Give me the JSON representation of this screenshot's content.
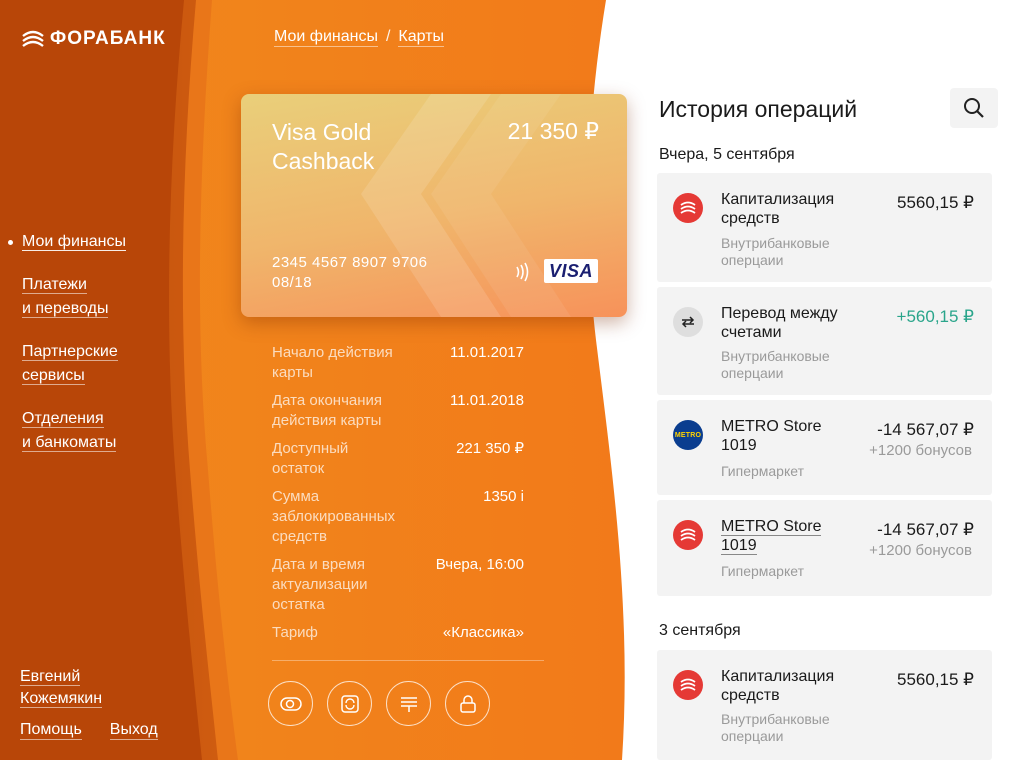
{
  "brand": {
    "name": "ФОРАБАНК"
  },
  "sidebar": {
    "items": [
      {
        "lines": [
          "Мои финансы"
        ],
        "active": true
      },
      {
        "lines": [
          "Платежи",
          "и переводы"
        ],
        "active": false
      },
      {
        "lines": [
          "Партнерские",
          "сервисы"
        ],
        "active": false
      },
      {
        "lines": [
          "Отделения",
          "и банкоматы"
        ],
        "active": false
      }
    ],
    "user": {
      "first_name": "Евгений",
      "last_name": "Кожемякин"
    },
    "help_label": "Помощь",
    "logout_label": "Выход"
  },
  "breadcrumb": {
    "root": "Мои финансы",
    "separator": "/",
    "current": "Карты"
  },
  "card": {
    "name_line1": "Visa Gold",
    "name_line2": "Cashback",
    "balance": "21 350 ₽",
    "number": "2345 4567 8907 9706",
    "expiry": "08/18",
    "network": "VISA"
  },
  "details": [
    {
      "label": [
        "Начало действия",
        "карты"
      ],
      "value": "11.01.2017"
    },
    {
      "label": [
        "Дата окончания",
        "действия карты"
      ],
      "value": "11.01.2018"
    },
    {
      "label": [
        "Доступный",
        "остаток"
      ],
      "value": "221 350 ₽"
    },
    {
      "label": [
        "Сумма",
        "заблокированных",
        "средств"
      ],
      "value": "1350 i"
    },
    {
      "label": [
        "Дата и время",
        "актуализации",
        "остатка"
      ],
      "value": "Вчера,  16:00"
    },
    {
      "label": [
        "Тариф"
      ],
      "value": "«Классика»"
    }
  ],
  "actions": [
    {
      "icon": "card-toggle-icon"
    },
    {
      "icon": "exchange-icon"
    },
    {
      "icon": "statement-icon"
    },
    {
      "icon": "lock-icon"
    }
  ],
  "history": {
    "title": "История операций",
    "groups": [
      {
        "title": "Вчера, 5 сентября",
        "operations": [
          {
            "icon": "bank-icon",
            "title": [
              "Капитализация",
              "средств"
            ],
            "subtitle": [
              "Внутрибанковые",
              "оперцаии"
            ],
            "amount": "5560,15 ₽",
            "bonus": ""
          },
          {
            "icon": "transfer-icon",
            "title": [
              "Перевод между",
              "счетами"
            ],
            "subtitle": [
              "Внутрибанковые",
              "оперцаии"
            ],
            "amount": "+560,15 ₽",
            "bonus": ""
          },
          {
            "icon": "metro-logo-icon",
            "title": [
              "METRO Store",
              "1019"
            ],
            "subtitle": [
              "Гипермаркет"
            ],
            "amount": "-14 567,07 ₽",
            "bonus": "+1200 бонусов"
          },
          {
            "icon": "bank-icon",
            "title": [
              "METRO Store",
              "1019"
            ],
            "subtitle": [
              "Гипермаркет"
            ],
            "amount": "-14 567,07 ₽",
            "bonus": "+1200 бонусов"
          }
        ]
      },
      {
        "title": "3 сентября",
        "operations": [
          {
            "icon": "bank-icon",
            "title": [
              "Капитализация",
              "средств"
            ],
            "subtitle": [
              "Внутрибанковые",
              "оперцаии"
            ],
            "amount": "5560,15 ₽",
            "bonus": ""
          }
        ]
      }
    ],
    "metro_logo_text": "METRO"
  },
  "colors": {
    "accent": "#f07d1e",
    "positive": "#2aa58b",
    "icon_red": "#e53935"
  }
}
